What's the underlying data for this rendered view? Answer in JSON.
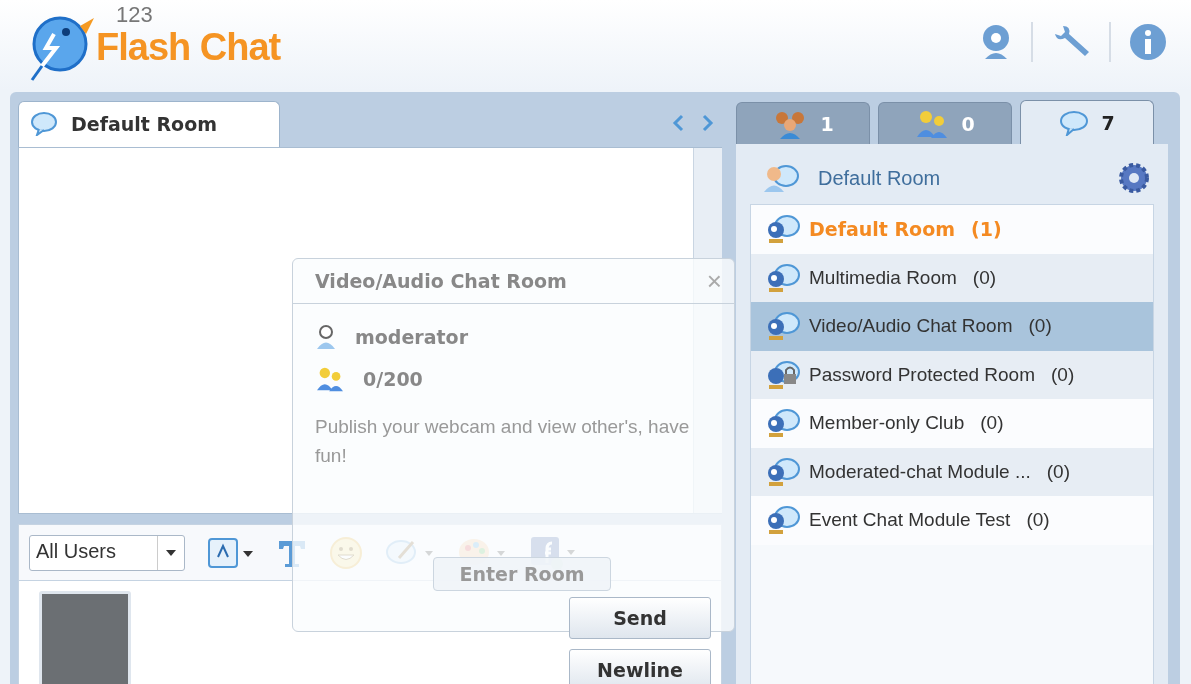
{
  "header": {
    "logo_number": "123",
    "logo_text": "Flash Chat"
  },
  "chat_tab": {
    "label": "Default Room",
    "selected": true
  },
  "toolbar": {
    "recipient": "All Users"
  },
  "buttons": {
    "send": "Send",
    "newline": "Newline"
  },
  "room_popup": {
    "title": "Video/Audio Chat Room",
    "close": "×",
    "owner": "moderator",
    "occupancy": "0/200",
    "description": "Publish your webcam and view other's, have fun!",
    "button": "Enter Room"
  },
  "side_tabs": [
    {
      "kind": "users",
      "count": "1",
      "selected": false
    },
    {
      "kind": "friends",
      "count": "0",
      "selected": false
    },
    {
      "kind": "rooms",
      "count": "7",
      "selected": true
    }
  ],
  "current_room": "Default Room",
  "rooms": [
    {
      "name": "Default Room",
      "count": "(1)",
      "kind": "webcam",
      "current": true,
      "selected": false
    },
    {
      "name": "Multimedia Room",
      "count": "(0)",
      "kind": "webcam",
      "current": false,
      "selected": false
    },
    {
      "name": "Video/Audio Chat Room",
      "count": "(0)",
      "kind": "webcam",
      "current": false,
      "selected": true
    },
    {
      "name": "Password Protected Room",
      "count": "(0)",
      "kind": "locked",
      "current": false,
      "selected": false
    },
    {
      "name": "Member-only Club",
      "count": "(0)",
      "kind": "webcam",
      "current": false,
      "selected": false
    },
    {
      "name": "Moderated-chat Module ...",
      "count": "(0)",
      "kind": "webcam",
      "current": false,
      "selected": false
    },
    {
      "name": "Event Chat Module Test",
      "count": "(0)",
      "kind": "webcam",
      "current": false,
      "selected": false
    }
  ]
}
